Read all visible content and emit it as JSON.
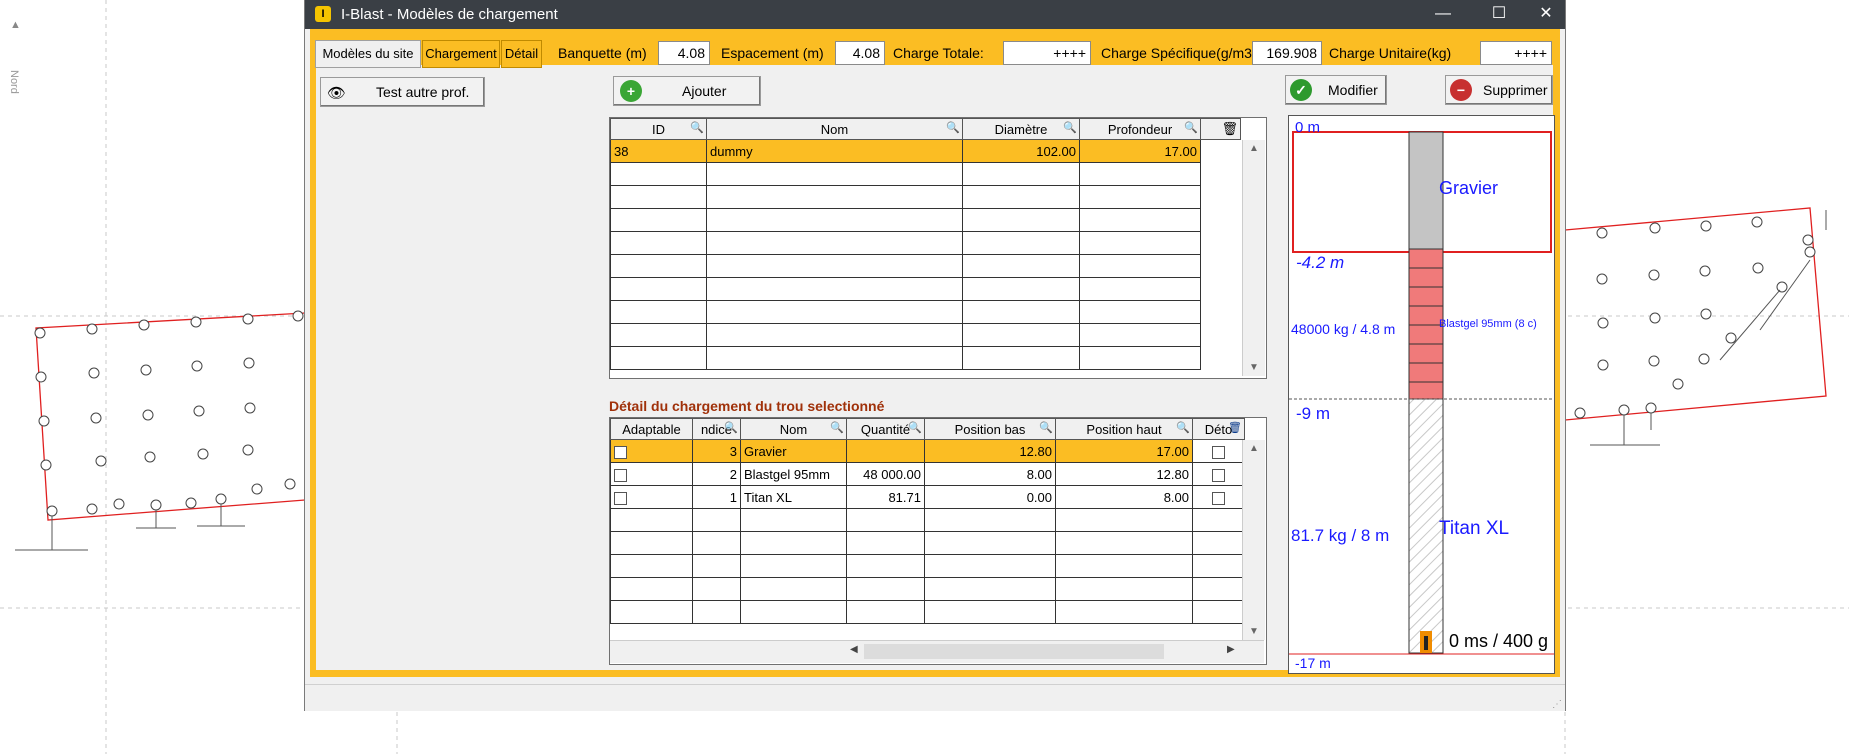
{
  "background": {
    "compass_label": "Nord"
  },
  "window": {
    "title": "I-Blast - Modèles de chargement",
    "controls": {
      "minimize": "—",
      "maximize": "☐",
      "close": "✕"
    }
  },
  "tabs": {
    "site": "Modèles du site",
    "chargement": "Chargement",
    "detail": "Détail"
  },
  "fields": {
    "banquette_label": "Banquette (m)",
    "banquette_value": "4.08",
    "espacement_label": "Espacement (m)",
    "espacement_value": "4.08",
    "charge_totale_label": "Charge Totale:",
    "charge_totale_value": "++++",
    "charge_specifique_label": "Charge Spécifique(g/m3)",
    "charge_specifique_value": "169.908",
    "charge_unitaire_label": "Charge Unitaire(kg)",
    "charge_unitaire_value": "++++"
  },
  "buttons": {
    "test": "Test autre prof.",
    "ajouter": "Ajouter",
    "modifier": "Modifier",
    "supprimer": "Supprimer"
  },
  "holes_table": {
    "headers": [
      "ID",
      "Nom",
      "Diamètre",
      "Profondeur"
    ],
    "rows": [
      [
        "38",
        "dummy",
        "102.00",
        "17.00"
      ]
    ]
  },
  "detail": {
    "title": "Détail du chargement du trou selectionné",
    "headers": [
      "Adaptable",
      "ndice",
      "Nom",
      "Quantité",
      "Position bas",
      "Position haut",
      "Déto"
    ],
    "rows": [
      [
        "",
        "3",
        "Gravier",
        "",
        "12.80",
        "17.00"
      ],
      [
        "",
        "2",
        "Blastgel 95mm",
        "48 000.00",
        "8.00",
        "12.80"
      ],
      [
        "",
        "1",
        "Titan XL",
        "81.71",
        "0.00",
        "8.00"
      ]
    ]
  },
  "diagram": {
    "depth_0": "0 m",
    "depth_1": "-4.2 m",
    "depth_2": "-9 m",
    "depth_3": "-17 m",
    "gravier_label": "Gravier",
    "blast_label": "Blastgel 95mm (8 c)",
    "blast_amount": "48000 kg / 4.8 m",
    "titan_label": "Titan XL",
    "titan_amount": "81.7 kg / 8 m",
    "delay": "0 ms / 400 g"
  },
  "colors": {
    "accent": "#fbbd23",
    "titlebar": "#3a3f45",
    "diagram_text": "#1a1aff",
    "outline_red": "#e02020"
  }
}
